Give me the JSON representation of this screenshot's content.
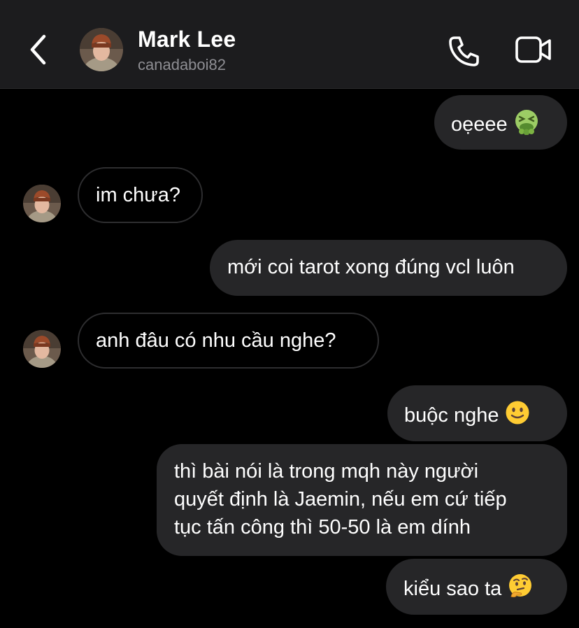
{
  "header": {
    "name": "Mark Lee",
    "handle": "canadaboi82"
  },
  "messages": [
    {
      "sender": "me",
      "text": "oẹeee",
      "emoji": "nauseated-face"
    },
    {
      "sender": "them",
      "text": "im chưa?"
    },
    {
      "sender": "me",
      "text": "mới coi tarot xong đúng vcl luôn"
    },
    {
      "sender": "them",
      "text": "anh đâu có nhu cầu nghe?"
    },
    {
      "sender": "me",
      "text": "buộc nghe",
      "emoji": "slightly-smiling-face"
    },
    {
      "sender": "me",
      "lines": [
        "thì bài nói là trong mqh này người",
        "quyết định là Jaemin, nếu em cứ tiếp",
        "tục tấn công thì 50-50 là em dính"
      ]
    },
    {
      "sender": "me",
      "text": "kiểu sao ta",
      "emoji": "thinking-face"
    }
  ],
  "colors": {
    "background": "#000000",
    "header_bg": "#1c1c1e",
    "sent_bubble": "#262628",
    "received_border": "#2e2e30",
    "secondary_text": "#8e8e93"
  }
}
